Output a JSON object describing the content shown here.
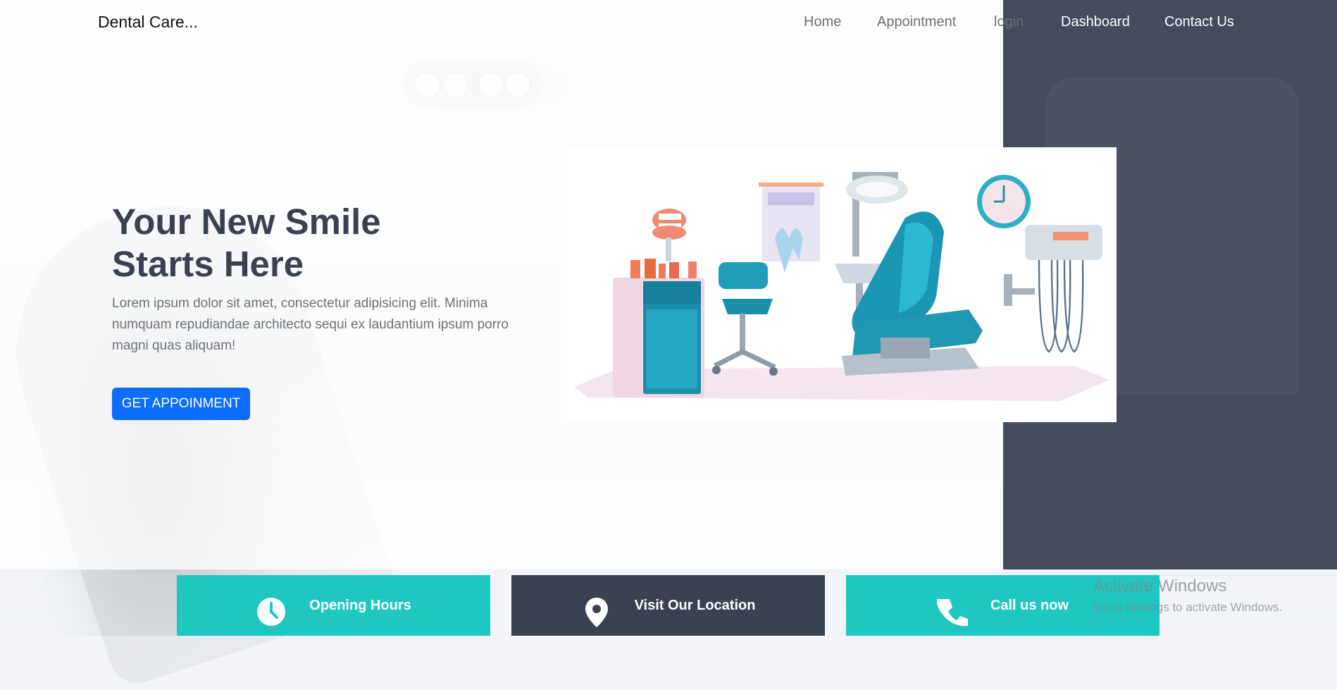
{
  "brand": "Dental Care...",
  "nav": {
    "home": "Home",
    "appointment": "Appointment",
    "login": "login",
    "dashboard": "Dashboard",
    "contact": "Contact Us"
  },
  "hero": {
    "title_line1": "Your New Smile",
    "title_line2": "Starts Here",
    "text": "Lorem ipsum dolor sit amet, consectetur adipisicing elit. Minima numquam repudiandae architecto sequi ex laudantium ipsum porro magni quas aliquam!",
    "cta": "GET APPOINMENT"
  },
  "cards": [
    {
      "icon": "clock-icon",
      "label": "Opening Hours"
    },
    {
      "icon": "location-pin-icon",
      "label": "Visit Our Location"
    },
    {
      "icon": "phone-icon",
      "label": "Call us now"
    }
  ],
  "watermark": {
    "title": "Activate Windows",
    "subtitle": "Go to Settings to activate Windows."
  },
  "colors": {
    "accent_blue": "#0d6efd",
    "teal": "#1ec8c0",
    "navy": "#3a4150",
    "dark_panel": "#444b5c"
  }
}
